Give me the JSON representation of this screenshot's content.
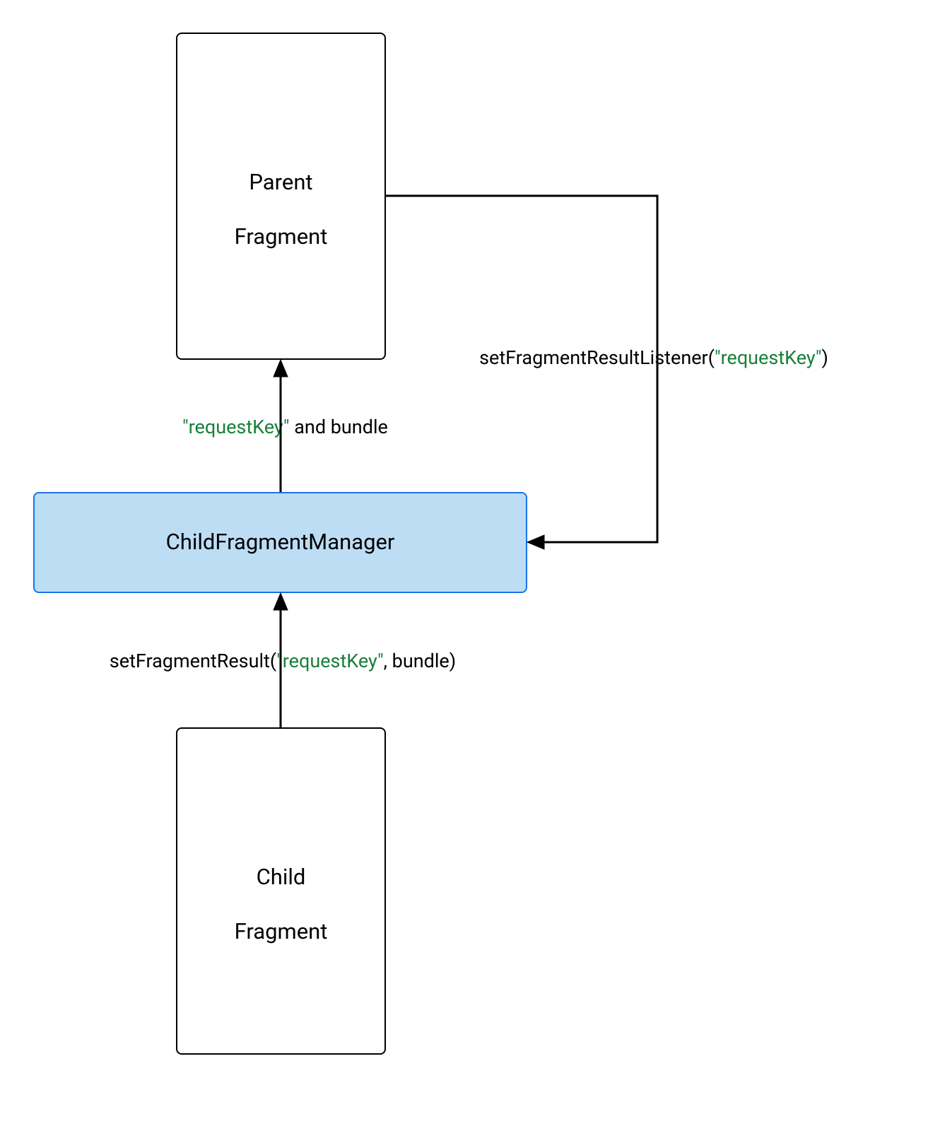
{
  "nodes": {
    "parent": {
      "line1": "Parent",
      "line2": "Fragment"
    },
    "manager": {
      "label": "ChildFragmentManager"
    },
    "child": {
      "line1": "Child",
      "line2": "Fragment"
    }
  },
  "edges": {
    "listener": {
      "prefix": "setFragmentResultListener(",
      "key": "\"requestKey\"",
      "suffix": ")"
    },
    "bundle_up": {
      "key": "\"requestKey\"",
      "rest": " and bundle"
    },
    "set_result": {
      "prefix": "setFragmentResult(",
      "key": "\"requestKey\"",
      "suffix": ", bundle)"
    }
  },
  "colors": {
    "key": "#188038",
    "manager_fill": "#bdddf4",
    "manager_border": "#1a73e8"
  }
}
